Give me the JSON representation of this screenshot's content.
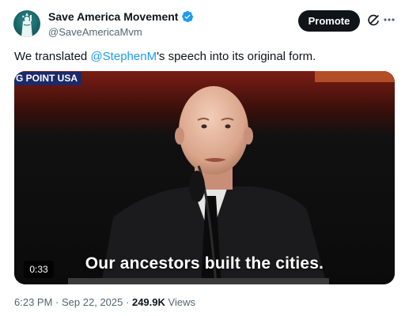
{
  "author": {
    "name": "Save America Movement",
    "handle": "@SaveAmericaMvm"
  },
  "actions": {
    "promote_label": "Promote"
  },
  "tweet": {
    "text_before": "We translated ",
    "mention": "@StephenM",
    "text_after": "'s speech into its original form."
  },
  "media": {
    "banner": "G POINT USA",
    "caption": "Our ancestors built the cities.",
    "duration": "0:33"
  },
  "meta": {
    "time": "6:23 PM",
    "separator": "·",
    "date": "Sep 22, 2025",
    "views_count": "249.9K",
    "views_label": "Views"
  },
  "colors": {
    "accent": "#1d9bf0",
    "verified": "#1d9bf0",
    "text_secondary": "#536471",
    "button": "#0f1419"
  }
}
